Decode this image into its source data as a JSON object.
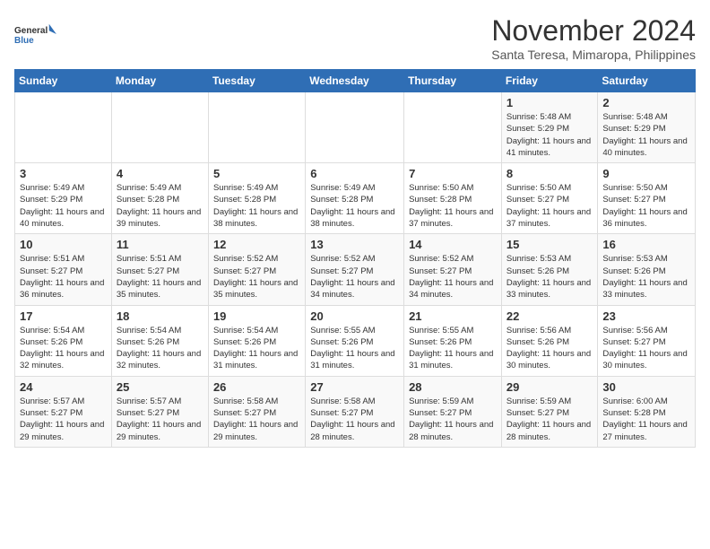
{
  "logo": {
    "line1": "General",
    "line2": "Blue"
  },
  "title": "November 2024",
  "subtitle": "Santa Teresa, Mimaropa, Philippines",
  "weekdays": [
    "Sunday",
    "Monday",
    "Tuesday",
    "Wednesday",
    "Thursday",
    "Friday",
    "Saturday"
  ],
  "weeks": [
    [
      {
        "day": "",
        "info": ""
      },
      {
        "day": "",
        "info": ""
      },
      {
        "day": "",
        "info": ""
      },
      {
        "day": "",
        "info": ""
      },
      {
        "day": "",
        "info": ""
      },
      {
        "day": "1",
        "info": "Sunrise: 5:48 AM\nSunset: 5:29 PM\nDaylight: 11 hours and 41 minutes."
      },
      {
        "day": "2",
        "info": "Sunrise: 5:48 AM\nSunset: 5:29 PM\nDaylight: 11 hours and 40 minutes."
      }
    ],
    [
      {
        "day": "3",
        "info": "Sunrise: 5:49 AM\nSunset: 5:29 PM\nDaylight: 11 hours and 40 minutes."
      },
      {
        "day": "4",
        "info": "Sunrise: 5:49 AM\nSunset: 5:28 PM\nDaylight: 11 hours and 39 minutes."
      },
      {
        "day": "5",
        "info": "Sunrise: 5:49 AM\nSunset: 5:28 PM\nDaylight: 11 hours and 38 minutes."
      },
      {
        "day": "6",
        "info": "Sunrise: 5:49 AM\nSunset: 5:28 PM\nDaylight: 11 hours and 38 minutes."
      },
      {
        "day": "7",
        "info": "Sunrise: 5:50 AM\nSunset: 5:28 PM\nDaylight: 11 hours and 37 minutes."
      },
      {
        "day": "8",
        "info": "Sunrise: 5:50 AM\nSunset: 5:27 PM\nDaylight: 11 hours and 37 minutes."
      },
      {
        "day": "9",
        "info": "Sunrise: 5:50 AM\nSunset: 5:27 PM\nDaylight: 11 hours and 36 minutes."
      }
    ],
    [
      {
        "day": "10",
        "info": "Sunrise: 5:51 AM\nSunset: 5:27 PM\nDaylight: 11 hours and 36 minutes."
      },
      {
        "day": "11",
        "info": "Sunrise: 5:51 AM\nSunset: 5:27 PM\nDaylight: 11 hours and 35 minutes."
      },
      {
        "day": "12",
        "info": "Sunrise: 5:52 AM\nSunset: 5:27 PM\nDaylight: 11 hours and 35 minutes."
      },
      {
        "day": "13",
        "info": "Sunrise: 5:52 AM\nSunset: 5:27 PM\nDaylight: 11 hours and 34 minutes."
      },
      {
        "day": "14",
        "info": "Sunrise: 5:52 AM\nSunset: 5:27 PM\nDaylight: 11 hours and 34 minutes."
      },
      {
        "day": "15",
        "info": "Sunrise: 5:53 AM\nSunset: 5:26 PM\nDaylight: 11 hours and 33 minutes."
      },
      {
        "day": "16",
        "info": "Sunrise: 5:53 AM\nSunset: 5:26 PM\nDaylight: 11 hours and 33 minutes."
      }
    ],
    [
      {
        "day": "17",
        "info": "Sunrise: 5:54 AM\nSunset: 5:26 PM\nDaylight: 11 hours and 32 minutes."
      },
      {
        "day": "18",
        "info": "Sunrise: 5:54 AM\nSunset: 5:26 PM\nDaylight: 11 hours and 32 minutes."
      },
      {
        "day": "19",
        "info": "Sunrise: 5:54 AM\nSunset: 5:26 PM\nDaylight: 11 hours and 31 minutes."
      },
      {
        "day": "20",
        "info": "Sunrise: 5:55 AM\nSunset: 5:26 PM\nDaylight: 11 hours and 31 minutes."
      },
      {
        "day": "21",
        "info": "Sunrise: 5:55 AM\nSunset: 5:26 PM\nDaylight: 11 hours and 31 minutes."
      },
      {
        "day": "22",
        "info": "Sunrise: 5:56 AM\nSunset: 5:26 PM\nDaylight: 11 hours and 30 minutes."
      },
      {
        "day": "23",
        "info": "Sunrise: 5:56 AM\nSunset: 5:27 PM\nDaylight: 11 hours and 30 minutes."
      }
    ],
    [
      {
        "day": "24",
        "info": "Sunrise: 5:57 AM\nSunset: 5:27 PM\nDaylight: 11 hours and 29 minutes."
      },
      {
        "day": "25",
        "info": "Sunrise: 5:57 AM\nSunset: 5:27 PM\nDaylight: 11 hours and 29 minutes."
      },
      {
        "day": "26",
        "info": "Sunrise: 5:58 AM\nSunset: 5:27 PM\nDaylight: 11 hours and 29 minutes."
      },
      {
        "day": "27",
        "info": "Sunrise: 5:58 AM\nSunset: 5:27 PM\nDaylight: 11 hours and 28 minutes."
      },
      {
        "day": "28",
        "info": "Sunrise: 5:59 AM\nSunset: 5:27 PM\nDaylight: 11 hours and 28 minutes."
      },
      {
        "day": "29",
        "info": "Sunrise: 5:59 AM\nSunset: 5:27 PM\nDaylight: 11 hours and 28 minutes."
      },
      {
        "day": "30",
        "info": "Sunrise: 6:00 AM\nSunset: 5:28 PM\nDaylight: 11 hours and 27 minutes."
      }
    ]
  ]
}
